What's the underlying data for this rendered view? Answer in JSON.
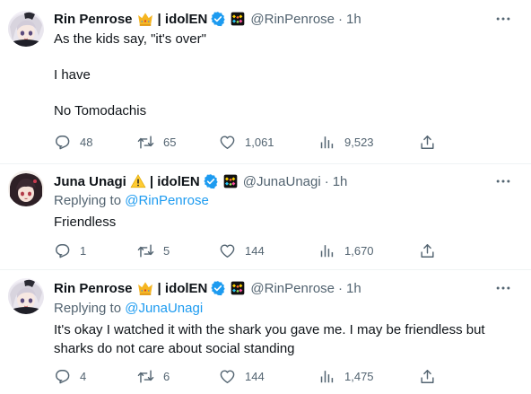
{
  "tweets": [
    {
      "author": {
        "name": "Rin Penrose",
        "badge_emoji": "crown-icon",
        "affiliation": "| idolEN",
        "handle": "@RinPenrose"
      },
      "time": "1h",
      "separator": "·",
      "replying_to": null,
      "body": [
        "As the kids say, \"it's over\"",
        "I have",
        "No Tomodachis"
      ],
      "stats": {
        "replies": "48",
        "retweets": "65",
        "likes": "1,061",
        "views": "9,523"
      }
    },
    {
      "author": {
        "name": "Juna Unagi",
        "badge_emoji": "warning-icon",
        "affiliation": "| idolEN",
        "handle": "@JunaUnagi"
      },
      "time": "1h",
      "separator": "·",
      "replying_to": {
        "prefix": "Replying to",
        "handle": "@RinPenrose"
      },
      "body": [
        "Friendless"
      ],
      "stats": {
        "replies": "1",
        "retweets": "5",
        "likes": "144",
        "views": "1,670"
      }
    },
    {
      "author": {
        "name": "Rin Penrose",
        "badge_emoji": "crown-icon",
        "affiliation": "| idolEN",
        "handle": "@RinPenrose"
      },
      "time": "1h",
      "separator": "·",
      "replying_to": {
        "prefix": "Replying to",
        "handle": "@JunaUnagi"
      },
      "body": [
        "It's okay I watched it with the shark you gave me. I may be friendless but sharks do not care about social standing"
      ],
      "stats": {
        "replies": "4",
        "retweets": "6",
        "likes": "144",
        "views": "1,475"
      }
    }
  ],
  "colors": {
    "text": "#0f1419",
    "muted": "#536471",
    "link": "#1d9bf0",
    "verified": "#1d9bf0",
    "separator": "#eff3f4"
  }
}
